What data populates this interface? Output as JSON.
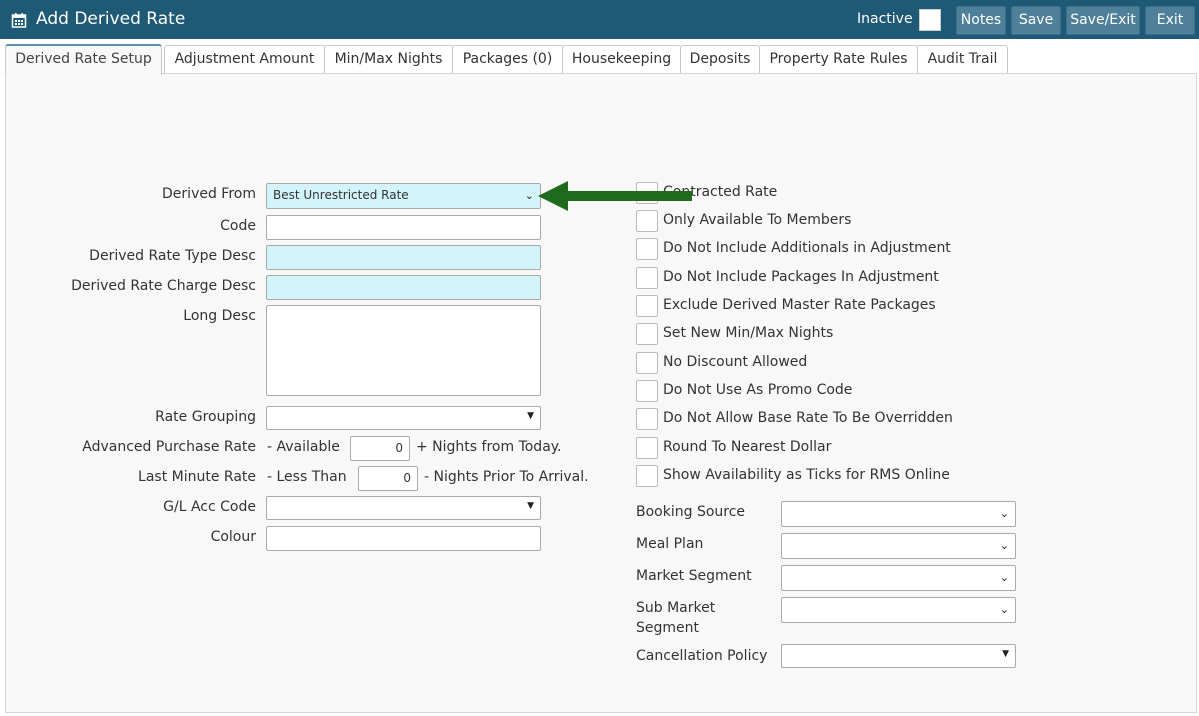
{
  "window": {
    "title": "Add Derived Rate",
    "inactive_label": "Inactive",
    "buttons": {
      "notes": "Notes",
      "save": "Save",
      "save_exit": "Save/Exit",
      "exit": "Exit"
    }
  },
  "tabs": [
    {
      "label": "Derived Rate Setup",
      "active": true
    },
    {
      "label": "Adjustment Amount"
    },
    {
      "label": "Min/Max Nights"
    },
    {
      "label": "Packages (0)"
    },
    {
      "label": "Housekeeping"
    },
    {
      "label": "Deposits"
    },
    {
      "label": "Property Rate Rules"
    },
    {
      "label": "Audit Trail"
    }
  ],
  "form": {
    "derived_from": {
      "label": "Derived From",
      "value": "Best Unrestricted Rate"
    },
    "code": {
      "label": "Code",
      "value": ""
    },
    "type_desc": {
      "label": "Derived Rate Type Desc",
      "value": ""
    },
    "charge_desc": {
      "label": "Derived Rate Charge Desc",
      "value": ""
    },
    "long_desc": {
      "label": "Long Desc",
      "value": ""
    },
    "rate_grouping": {
      "label": "Rate Grouping",
      "value": ""
    },
    "advanced_purchase": {
      "label": "Advanced Purchase Rate",
      "prefix": "- Available",
      "value": "0",
      "suffix": "+ Nights from Today."
    },
    "last_minute": {
      "label": "Last Minute Rate",
      "prefix": "- Less Than",
      "value": "0",
      "suffix": "- Nights Prior To Arrival."
    },
    "gl_acc_code": {
      "label": "G/L Acc Code",
      "value": ""
    },
    "colour": {
      "label": "Colour",
      "value": ""
    }
  },
  "checkboxes": [
    {
      "label": "Contracted Rate",
      "checked": false
    },
    {
      "label": "Only Available To Members",
      "checked": false
    },
    {
      "label": "Do Not Include Additionals in Adjustment",
      "checked": false
    },
    {
      "label": "Do Not Include Packages In Adjustment",
      "checked": false
    },
    {
      "label": "Exclude Derived Master Rate Packages",
      "checked": false
    },
    {
      "label": "Set New Min/Max Nights",
      "checked": false
    },
    {
      "label": "No Discount Allowed",
      "checked": false
    },
    {
      "label": "Do Not Use As Promo Code",
      "checked": false
    },
    {
      "label": "Do Not Allow Base Rate To Be Overridden",
      "checked": false
    },
    {
      "label": "Round To Nearest Dollar",
      "checked": false
    },
    {
      "label": "Show Availability as Ticks for RMS Online",
      "checked": false
    }
  ],
  "right_selects": {
    "booking_source": {
      "label": "Booking Source",
      "value": ""
    },
    "meal_plan": {
      "label": "Meal Plan",
      "value": ""
    },
    "market_segment": {
      "label": "Market Segment",
      "value": ""
    },
    "sub_market_segment": {
      "label_line1": "Sub Market",
      "label_line2": "Segment",
      "value": ""
    },
    "cancellation_policy": {
      "label": "Cancellation Policy",
      "value": ""
    }
  },
  "icons": {
    "title": "calendar-icon",
    "arrow": "green-arrow-pointer",
    "chevron": "chevron-down-icon",
    "triangle": "triangle-down-icon"
  },
  "colors": {
    "titlebar": "#1e5a75",
    "button": "#4f8099",
    "cyan_field": "#d3f4fb",
    "arrow": "#1e6b1e",
    "active_tab_border": "#5a8eaa"
  }
}
